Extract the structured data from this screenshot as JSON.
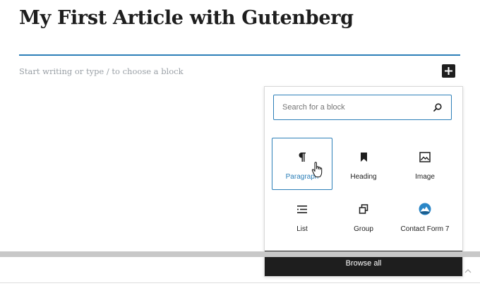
{
  "post": {
    "title": "My First Article with Gutenberg",
    "body_placeholder": "Start writing or type / to choose a block"
  },
  "inserter": {
    "toggle_icon": "plus-icon",
    "search": {
      "placeholder": "Search for a block",
      "value": "",
      "icon": "search-icon"
    },
    "blocks": [
      {
        "label": "Paragraph",
        "icon": "paragraph-icon",
        "selected": true
      },
      {
        "label": "Heading",
        "icon": "bookmark-icon",
        "selected": false
      },
      {
        "label": "Image",
        "icon": "image-icon",
        "selected": false
      },
      {
        "label": "List",
        "icon": "list-icon",
        "selected": false
      },
      {
        "label": "Group",
        "icon": "group-icon",
        "selected": false
      },
      {
        "label": "Contact Form 7",
        "icon": "contact-form-7-icon",
        "selected": false
      }
    ],
    "browse_all_label": "Browse all"
  },
  "colors": {
    "accent": "#2c7fb8",
    "dark": "#1e1e1e",
    "placeholder_text": "#9aa0a6"
  }
}
